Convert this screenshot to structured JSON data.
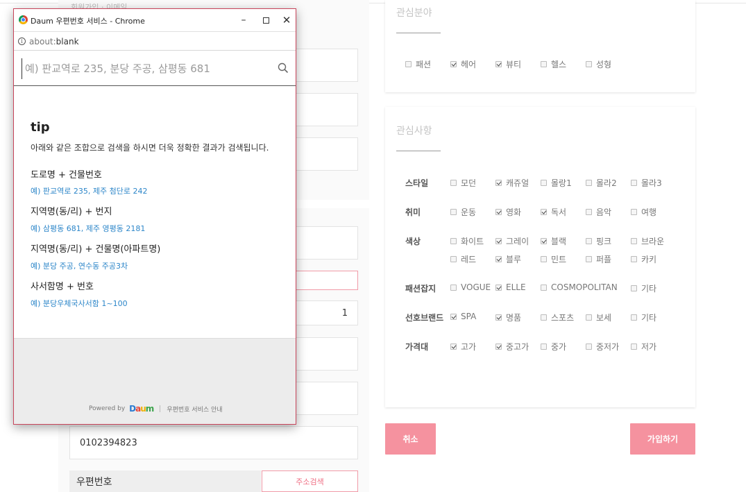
{
  "background_form": {
    "partial_header": "회원가입 · 이메일",
    "phone_value": "0102394823",
    "partial_digit": "1",
    "zip_label": "우편번호",
    "zip_button": "주소검색"
  },
  "interest_field": {
    "title": "관심분야",
    "options": [
      {
        "label": "패션",
        "checked": false
      },
      {
        "label": "헤어",
        "checked": true
      },
      {
        "label": "뷰티",
        "checked": true
      },
      {
        "label": "헬스",
        "checked": false
      },
      {
        "label": "성형",
        "checked": false
      }
    ]
  },
  "interest_items": {
    "title": "관심사항",
    "rows": [
      {
        "label": "스타일",
        "options": [
          {
            "label": "모던",
            "checked": false
          },
          {
            "label": "캐쥬얼",
            "checked": true
          },
          {
            "label": "몰랑1",
            "checked": false
          },
          {
            "label": "몰라2",
            "checked": false
          },
          {
            "label": "몰라3",
            "checked": false
          }
        ]
      },
      {
        "label": "취미",
        "options": [
          {
            "label": "운동",
            "checked": false
          },
          {
            "label": "영화",
            "checked": true
          },
          {
            "label": "독서",
            "checked": true
          },
          {
            "label": "음악",
            "checked": false
          },
          {
            "label": "여행",
            "checked": false
          }
        ]
      },
      {
        "label": "색상",
        "options": [
          {
            "label": "화이트",
            "checked": false
          },
          {
            "label": "그레이",
            "checked": true
          },
          {
            "label": "블랙",
            "checked": true
          },
          {
            "label": "핑크",
            "checked": false
          },
          {
            "label": "브라운",
            "checked": false
          },
          {
            "label": "레드",
            "checked": false
          },
          {
            "label": "블루",
            "checked": true
          },
          {
            "label": "민트",
            "checked": false
          },
          {
            "label": "퍼플",
            "checked": false
          },
          {
            "label": "카키",
            "checked": false
          }
        ]
      },
      {
        "label": "패션잡지",
        "options": [
          {
            "label": "VOGUE",
            "checked": false
          },
          {
            "label": "ELLE",
            "checked": true
          },
          {
            "label": "COSMOPOLITAN",
            "checked": false
          },
          {
            "label": "기타",
            "checked": false
          }
        ]
      },
      {
        "label": "선호브랜드",
        "options": [
          {
            "label": "SPA",
            "checked": true
          },
          {
            "label": "명품",
            "checked": true
          },
          {
            "label": "스포츠",
            "checked": false
          },
          {
            "label": "보세",
            "checked": false
          },
          {
            "label": "기타",
            "checked": false
          }
        ]
      },
      {
        "label": "가격대",
        "options": [
          {
            "label": "고가",
            "checked": true
          },
          {
            "label": "중고가",
            "checked": true
          },
          {
            "label": "중가",
            "checked": false
          },
          {
            "label": "중저가",
            "checked": false
          },
          {
            "label": "저가",
            "checked": false
          }
        ]
      }
    ]
  },
  "buttons": {
    "cancel": "취소",
    "signup": "가입하기"
  },
  "popup": {
    "window_title": "Daum 우편번호 서비스 - Chrome",
    "url_prefix": "about:",
    "url_suffix": "blank",
    "search_placeholder": "예) 판교역로 235, 분당 주공, 삼평동 681",
    "tip_title": "tip",
    "tip_desc": "아래와 같은 조합으로 검색을 하시면 더욱 정확한 결과가 검색됩니다.",
    "tips": [
      {
        "head": "도로명 + 건물번호",
        "example": "예) 판교역로 235,  제주 첨단로 242"
      },
      {
        "head": "지역명(동/리) + 번지",
        "example": "예) 삼평동 681,  제주 영평동 2181"
      },
      {
        "head": "지역명(동/리) + 건물명(아파트명)",
        "example": "예) 분당 주공,  연수동 주공3차"
      },
      {
        "head": "사서함명 + 번호",
        "example": "예) 분당우체국사서함 1~100"
      }
    ],
    "powered_by": "Powered by",
    "service_info": "우편번호 서비스 안내",
    "logo_text": "Daum",
    "colors": {
      "border": "#c8445a",
      "link": "#2c86c9"
    }
  },
  "colors": {
    "accent": "#f5929f"
  }
}
